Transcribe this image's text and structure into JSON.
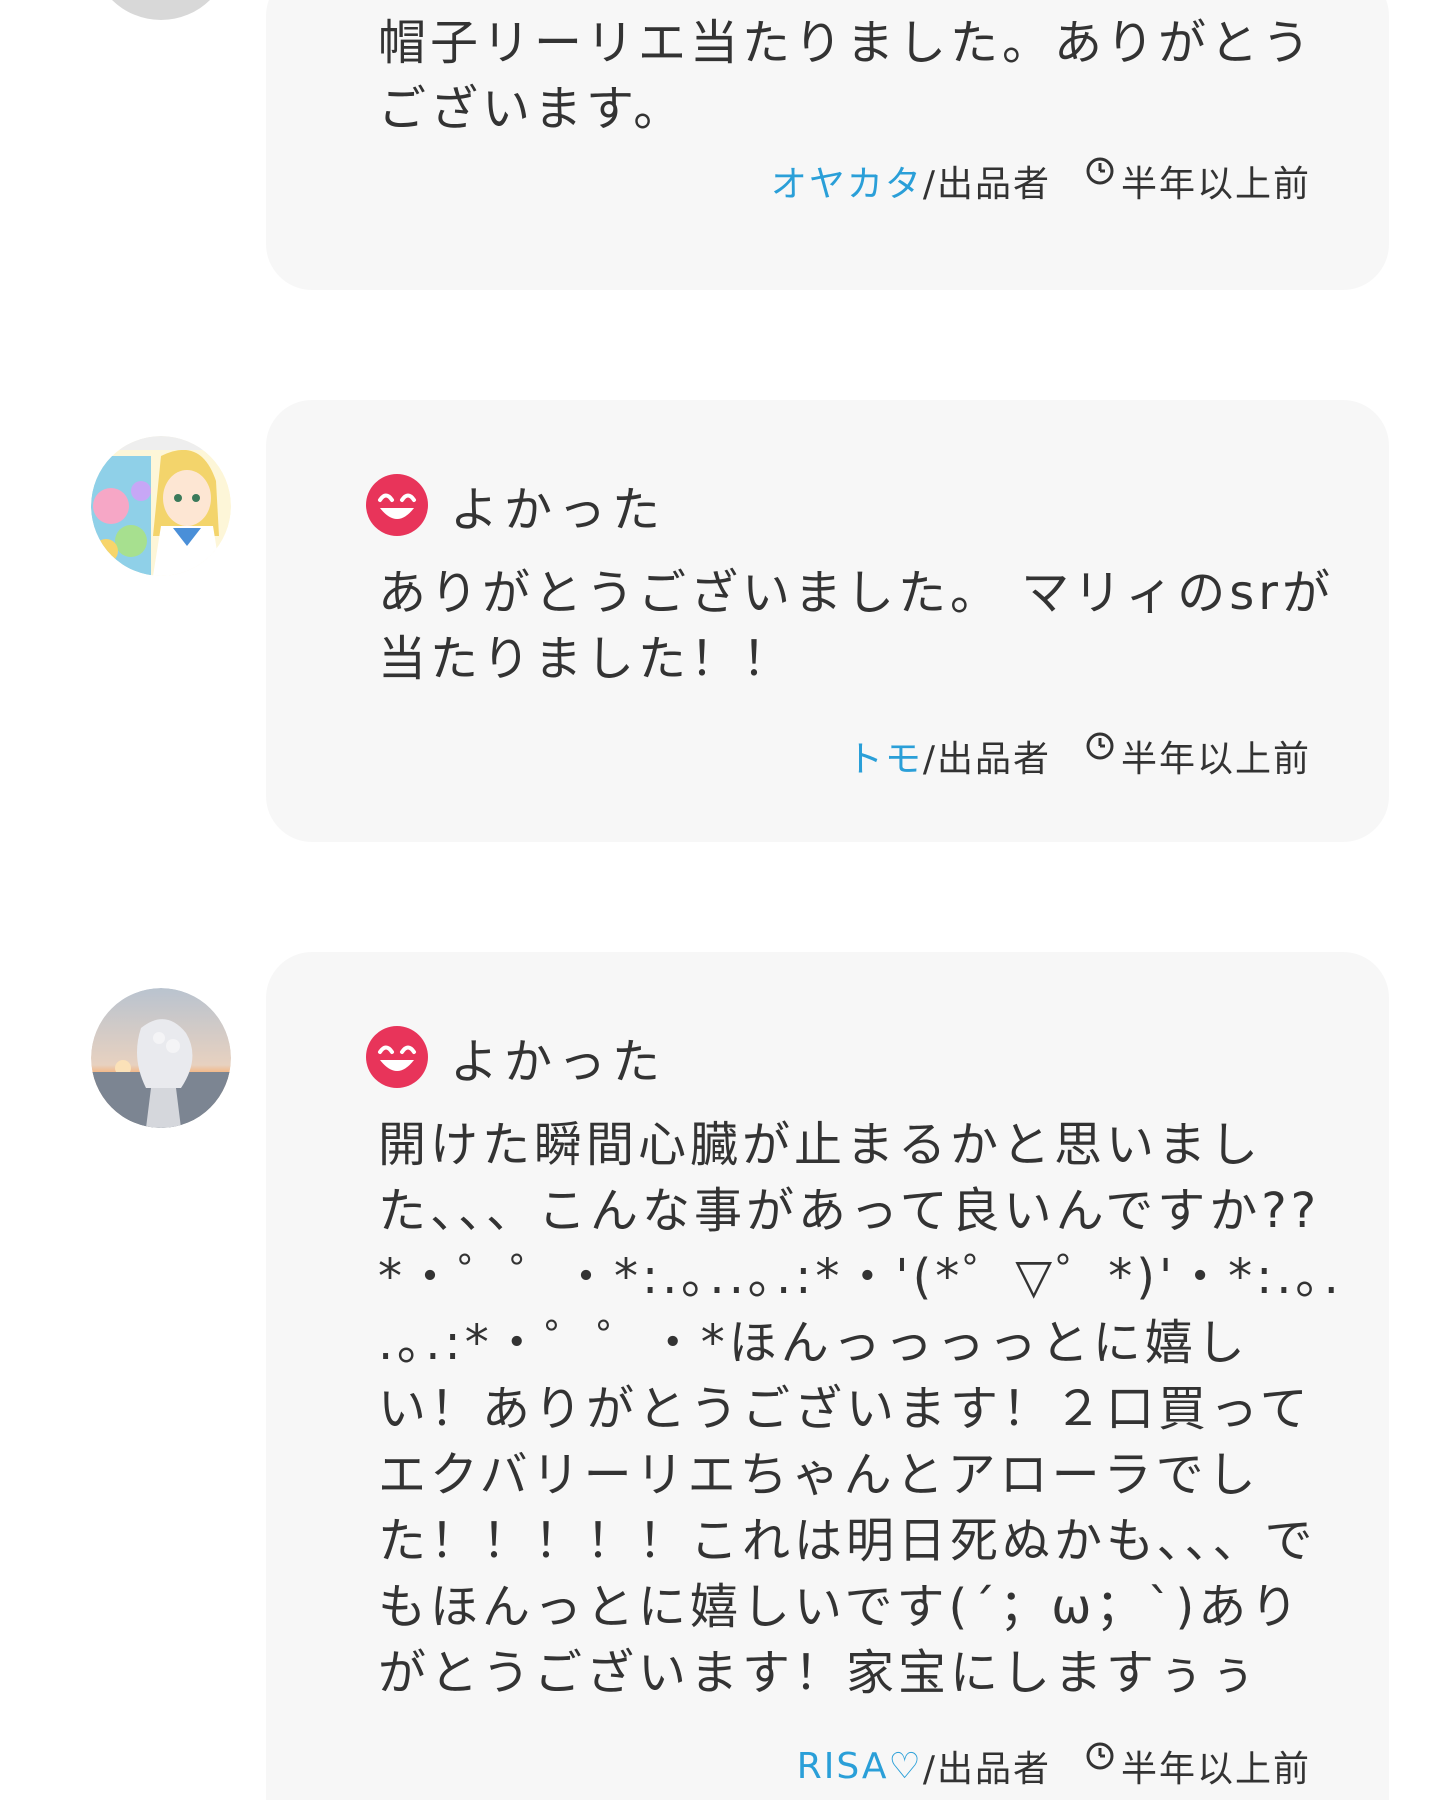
{
  "reviews": [
    {
      "comment": "帽子リーリエ当たりました。ありがとうございます。",
      "author": "オヤカタ",
      "role": "/出品者",
      "time": "半年以上前"
    },
    {
      "reaction": "よかった",
      "comment": "ありがとうございました。 マリィのsrが当たりました！！",
      "author": "トモ",
      "role": "/出品者",
      "time": "半年以上前"
    },
    {
      "reaction": "よかった",
      "comment": "開けた瞬間心臓が止まるかと思いました、、、こんな事があって良いんですか?? *・゜゜・*:.｡..｡.:*・'(*゜▽゜*)'・*:.｡. .｡.:*・゜゜・*ほんっっっっとに嬉しい！ありがとうございます！２口買ってエクバリーリエちゃんとアローラでした！！！！！これは明日死ぬかも、、、でもほんっとに嬉しいです(´；ω；`)ありがとうございます！家宝にしますぅぅ",
      "author": "RISA♡",
      "role": "/出品者",
      "time": "半年以上前"
    }
  ],
  "icons": {
    "reaction": "grinning-face-icon",
    "clock": "clock-icon"
  },
  "colors": {
    "author_link": "#2a9fd8",
    "reaction_icon": "#e8345a",
    "card_background": "#f7f7f7",
    "text": "#333333"
  }
}
